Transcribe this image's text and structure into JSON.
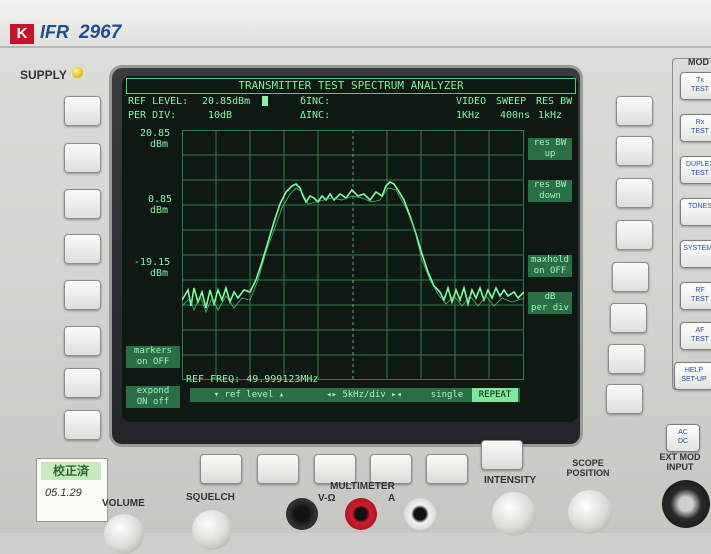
{
  "brand": {
    "logo_letter": "K",
    "name": "IFR",
    "model": "2967"
  },
  "panel_labels": {
    "supply": "SUPPLY",
    "mode": "MOD",
    "volume": "VOLUME",
    "squelch": "SQUELCH",
    "multimeter": "MULTIMETER",
    "v_ohm": "V-Ω",
    "amp": "A",
    "intensity": "INTENSITY",
    "scope_position": "SCOPE POSITION",
    "ext_mod_input": "EXT MOD INPUT"
  },
  "sticker": {
    "stamp": "校正済",
    "date": "05.1.29"
  },
  "screen": {
    "title": "TRANSMITTER TEST SPECTRUM ANALYZER",
    "ref_level_label": "REF LEVEL:",
    "ref_level_value": "20.85dBm",
    "per_div_label": "PER DIV:",
    "per_div_value": "10dB",
    "delta_inc_1": "δINC:",
    "delta_inc_2": "ΔINC:",
    "video_label": "VIDEO",
    "video_value": "1KHz",
    "sweep_label": "SWEEP",
    "sweep_value": "400ns",
    "resbw_label": "RES BW",
    "resbw_value": "1kHz",
    "y_labels": [
      {
        "value": "20.85",
        "unit": "dBm"
      },
      {
        "value": "0.85",
        "unit": "dBm"
      },
      {
        "value": "-19.15",
        "unit": "dBm"
      }
    ],
    "right_softkeys": [
      {
        "line1": "res BW",
        "line2": "up"
      },
      {
        "line1": "res BW",
        "line2": "down"
      },
      {
        "line1": "maxhold",
        "line2": "on OFF"
      },
      {
        "line1": "dB",
        "line2": "per div"
      }
    ],
    "left_softkeys": [
      {
        "line1": "markers",
        "line2": "on OFF"
      },
      {
        "line1": "expond",
        "line2": "ON off"
      }
    ],
    "ref_freq": "REF FREQ: 49.999123MHz",
    "bottom_bar": {
      "ref_level": "▾ ref level ▴",
      "kHz_div": "◂▸  5kHz/div  ▸◂",
      "single": "single",
      "repeat": "REPEAT"
    }
  },
  "mode_buttons": [
    {
      "line1": "Tx",
      "line2": "TEST"
    },
    {
      "line1": "Rx",
      "line2": "TEST"
    },
    {
      "line1": "DUPLEX",
      "line2": "TEST"
    },
    {
      "line1": "TONES",
      "line2": ""
    },
    {
      "line1": "SYSTEMS",
      "line2": ""
    },
    {
      "line1": "RF",
      "line2": "TEST"
    },
    {
      "line1": "AF",
      "line2": "TEST"
    },
    {
      "line1": "HELP",
      "line2": "SET-UP"
    },
    {
      "line1": "AC",
      "line2": "DC"
    }
  ]
}
